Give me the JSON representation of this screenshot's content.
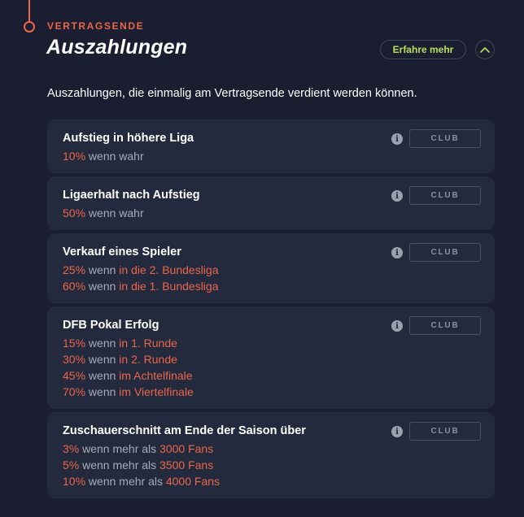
{
  "section": {
    "kicker": "VERTRAGSENDE",
    "title": "Auszahlungen",
    "learn_more": "Erfahre mehr",
    "intro": "Auszahlungen, die einmalig am Vertragsende verdient werden können."
  },
  "colors": {
    "accent": "#e8664a",
    "learn_more": "#b7e05a",
    "card": "#242a3d",
    "background": "#1a1e30"
  },
  "cards": [
    {
      "title": "Aufstieg in höhere Liga",
      "badge": "CLUB",
      "lines": [
        {
          "pct": "10%",
          "text": " wenn wahr",
          "cond": ""
        }
      ]
    },
    {
      "title": "Ligaerhalt nach Aufstieg",
      "badge": "CLUB",
      "lines": [
        {
          "pct": "50%",
          "text": " wenn wahr",
          "cond": ""
        }
      ]
    },
    {
      "title": "Verkauf eines Spieler",
      "badge": "CLUB",
      "lines": [
        {
          "pct": "25%",
          "text": " wenn ",
          "cond": "in die 2. Bundesliga"
        },
        {
          "pct": "60%",
          "text": " wenn ",
          "cond": "in die 1. Bundesliga"
        }
      ]
    },
    {
      "title": "DFB Pokal Erfolg",
      "badge": "CLUB",
      "lines": [
        {
          "pct": "15%",
          "text": " wenn ",
          "cond": "in 1. Runde"
        },
        {
          "pct": "30%",
          "text": " wenn ",
          "cond": "in 2. Runde"
        },
        {
          "pct": "45%",
          "text": " wenn ",
          "cond": "im Achtelfinale"
        },
        {
          "pct": "70%",
          "text": " wenn ",
          "cond": "im Viertelfinale"
        }
      ]
    },
    {
      "title": "Zuschauerschnitt am Ende der Saison über",
      "badge": "CLUB",
      "lines": [
        {
          "pct": "3%",
          "text": " wenn mehr als ",
          "cond": "3000 Fans"
        },
        {
          "pct": "5%",
          "text": " wenn mehr als ",
          "cond": "3500 Fans"
        },
        {
          "pct": "10%",
          "text": " wenn mehr als ",
          "cond": "4000 Fans"
        }
      ]
    }
  ]
}
